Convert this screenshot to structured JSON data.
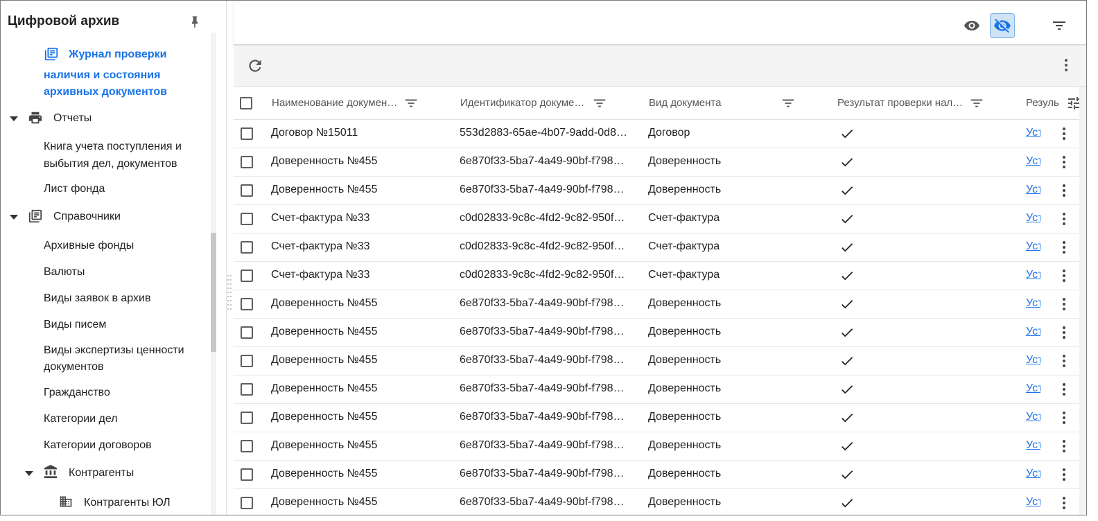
{
  "app": {
    "title": "Цифровой архив"
  },
  "sidebar": {
    "active_item": "Журнал проверки наличия и состояния архивных документов",
    "active_lines": [
      "Журнал проверки",
      "наличия и состояния",
      "архивных документов"
    ],
    "reports": {
      "label": "Отчеты",
      "items": [
        {
          "lines": [
            "Книга учета поступления и",
            "выбытия дел, документов"
          ]
        },
        {
          "lines": [
            "Лист фонда"
          ]
        }
      ]
    },
    "directories": {
      "label": "Справочники",
      "items": [
        {
          "lines": [
            "Архивные фонды"
          ]
        },
        {
          "lines": [
            "Валюты"
          ]
        },
        {
          "lines": [
            "Виды заявок в архив"
          ]
        },
        {
          "lines": [
            "Виды писем"
          ]
        },
        {
          "lines": [
            "Виды экспертизы ценности",
            "документов"
          ]
        },
        {
          "lines": [
            "Гражданство"
          ]
        },
        {
          "lines": [
            "Категории дел"
          ]
        },
        {
          "lines": [
            "Категории договоров"
          ]
        }
      ]
    },
    "counterparties": {
      "label": "Контрагенты",
      "items": [
        {
          "lines": [
            "Контрагенты ЮЛ"
          ]
        }
      ]
    }
  },
  "table": {
    "columns": [
      "Наименование докумен…",
      "Идентификатор докуме…",
      "Вид документа",
      "Результат проверки нал…",
      "Резуль"
    ],
    "rows": [
      {
        "name": "Договор №15011",
        "id": "553d2883-65ae-4b07-9add-0d8…",
        "type": "Договор",
        "presence": "✓",
        "state": "Уст"
      },
      {
        "name": "Доверенность №455",
        "id": "6e870f33-5ba7-4a49-90bf-f798…",
        "type": "Доверенность",
        "presence": "✓",
        "state": "Уст"
      },
      {
        "name": "Доверенность №455",
        "id": "6e870f33-5ba7-4a49-90bf-f798…",
        "type": "Доверенность",
        "presence": "✓",
        "state": "Уст"
      },
      {
        "name": "Счет-фактура №33",
        "id": "c0d02833-9c8c-4fd2-9c82-950f…",
        "type": "Счет-фактура",
        "presence": "✓",
        "state": "Уст"
      },
      {
        "name": "Счет-фактура №33",
        "id": "c0d02833-9c8c-4fd2-9c82-950f…",
        "type": "Счет-фактура",
        "presence": "✓",
        "state": "Уст"
      },
      {
        "name": "Счет-фактура №33",
        "id": "c0d02833-9c8c-4fd2-9c82-950f…",
        "type": "Счет-фактура",
        "presence": "✓",
        "state": "Уст"
      },
      {
        "name": "Доверенность №455",
        "id": "6e870f33-5ba7-4a49-90bf-f798…",
        "type": "Доверенность",
        "presence": "✓",
        "state": "Уст"
      },
      {
        "name": "Доверенность №455",
        "id": "6e870f33-5ba7-4a49-90bf-f798…",
        "type": "Доверенность",
        "presence": "✓",
        "state": "Уст"
      },
      {
        "name": "Доверенность №455",
        "id": "6e870f33-5ba7-4a49-90bf-f798…",
        "type": "Доверенность",
        "presence": "✓",
        "state": "Уст"
      },
      {
        "name": "Доверенность №455",
        "id": "6e870f33-5ba7-4a49-90bf-f798…",
        "type": "Доверенность",
        "presence": "✓",
        "state": "Уст"
      },
      {
        "name": "Доверенность №455",
        "id": "6e870f33-5ba7-4a49-90bf-f798…",
        "type": "Доверенность",
        "presence": "✓",
        "state": "Уст"
      },
      {
        "name": "Доверенность №455",
        "id": "6e870f33-5ba7-4a49-90bf-f798…",
        "type": "Доверенность",
        "presence": "✓",
        "state": "Уст"
      },
      {
        "name": "Доверенность №455",
        "id": "6e870f33-5ba7-4a49-90bf-f798…",
        "type": "Доверенность",
        "presence": "✓",
        "state": "Уст"
      },
      {
        "name": "Доверенность №455",
        "id": "6e870f33-5ba7-4a49-90bf-f798…",
        "type": "Доверенность",
        "presence": "✓",
        "state": "Уст"
      }
    ]
  },
  "icons": {
    "show": "eye-icon",
    "hide": "eye-off-icon",
    "filter": "filter-icon",
    "refresh": "refresh-icon",
    "more": "more-vert-icon",
    "columns": "tune-icon",
    "pin": "pin-icon"
  },
  "colors": {
    "accent": "#1a73e8",
    "toggle_bg": "#cfe3f7"
  }
}
